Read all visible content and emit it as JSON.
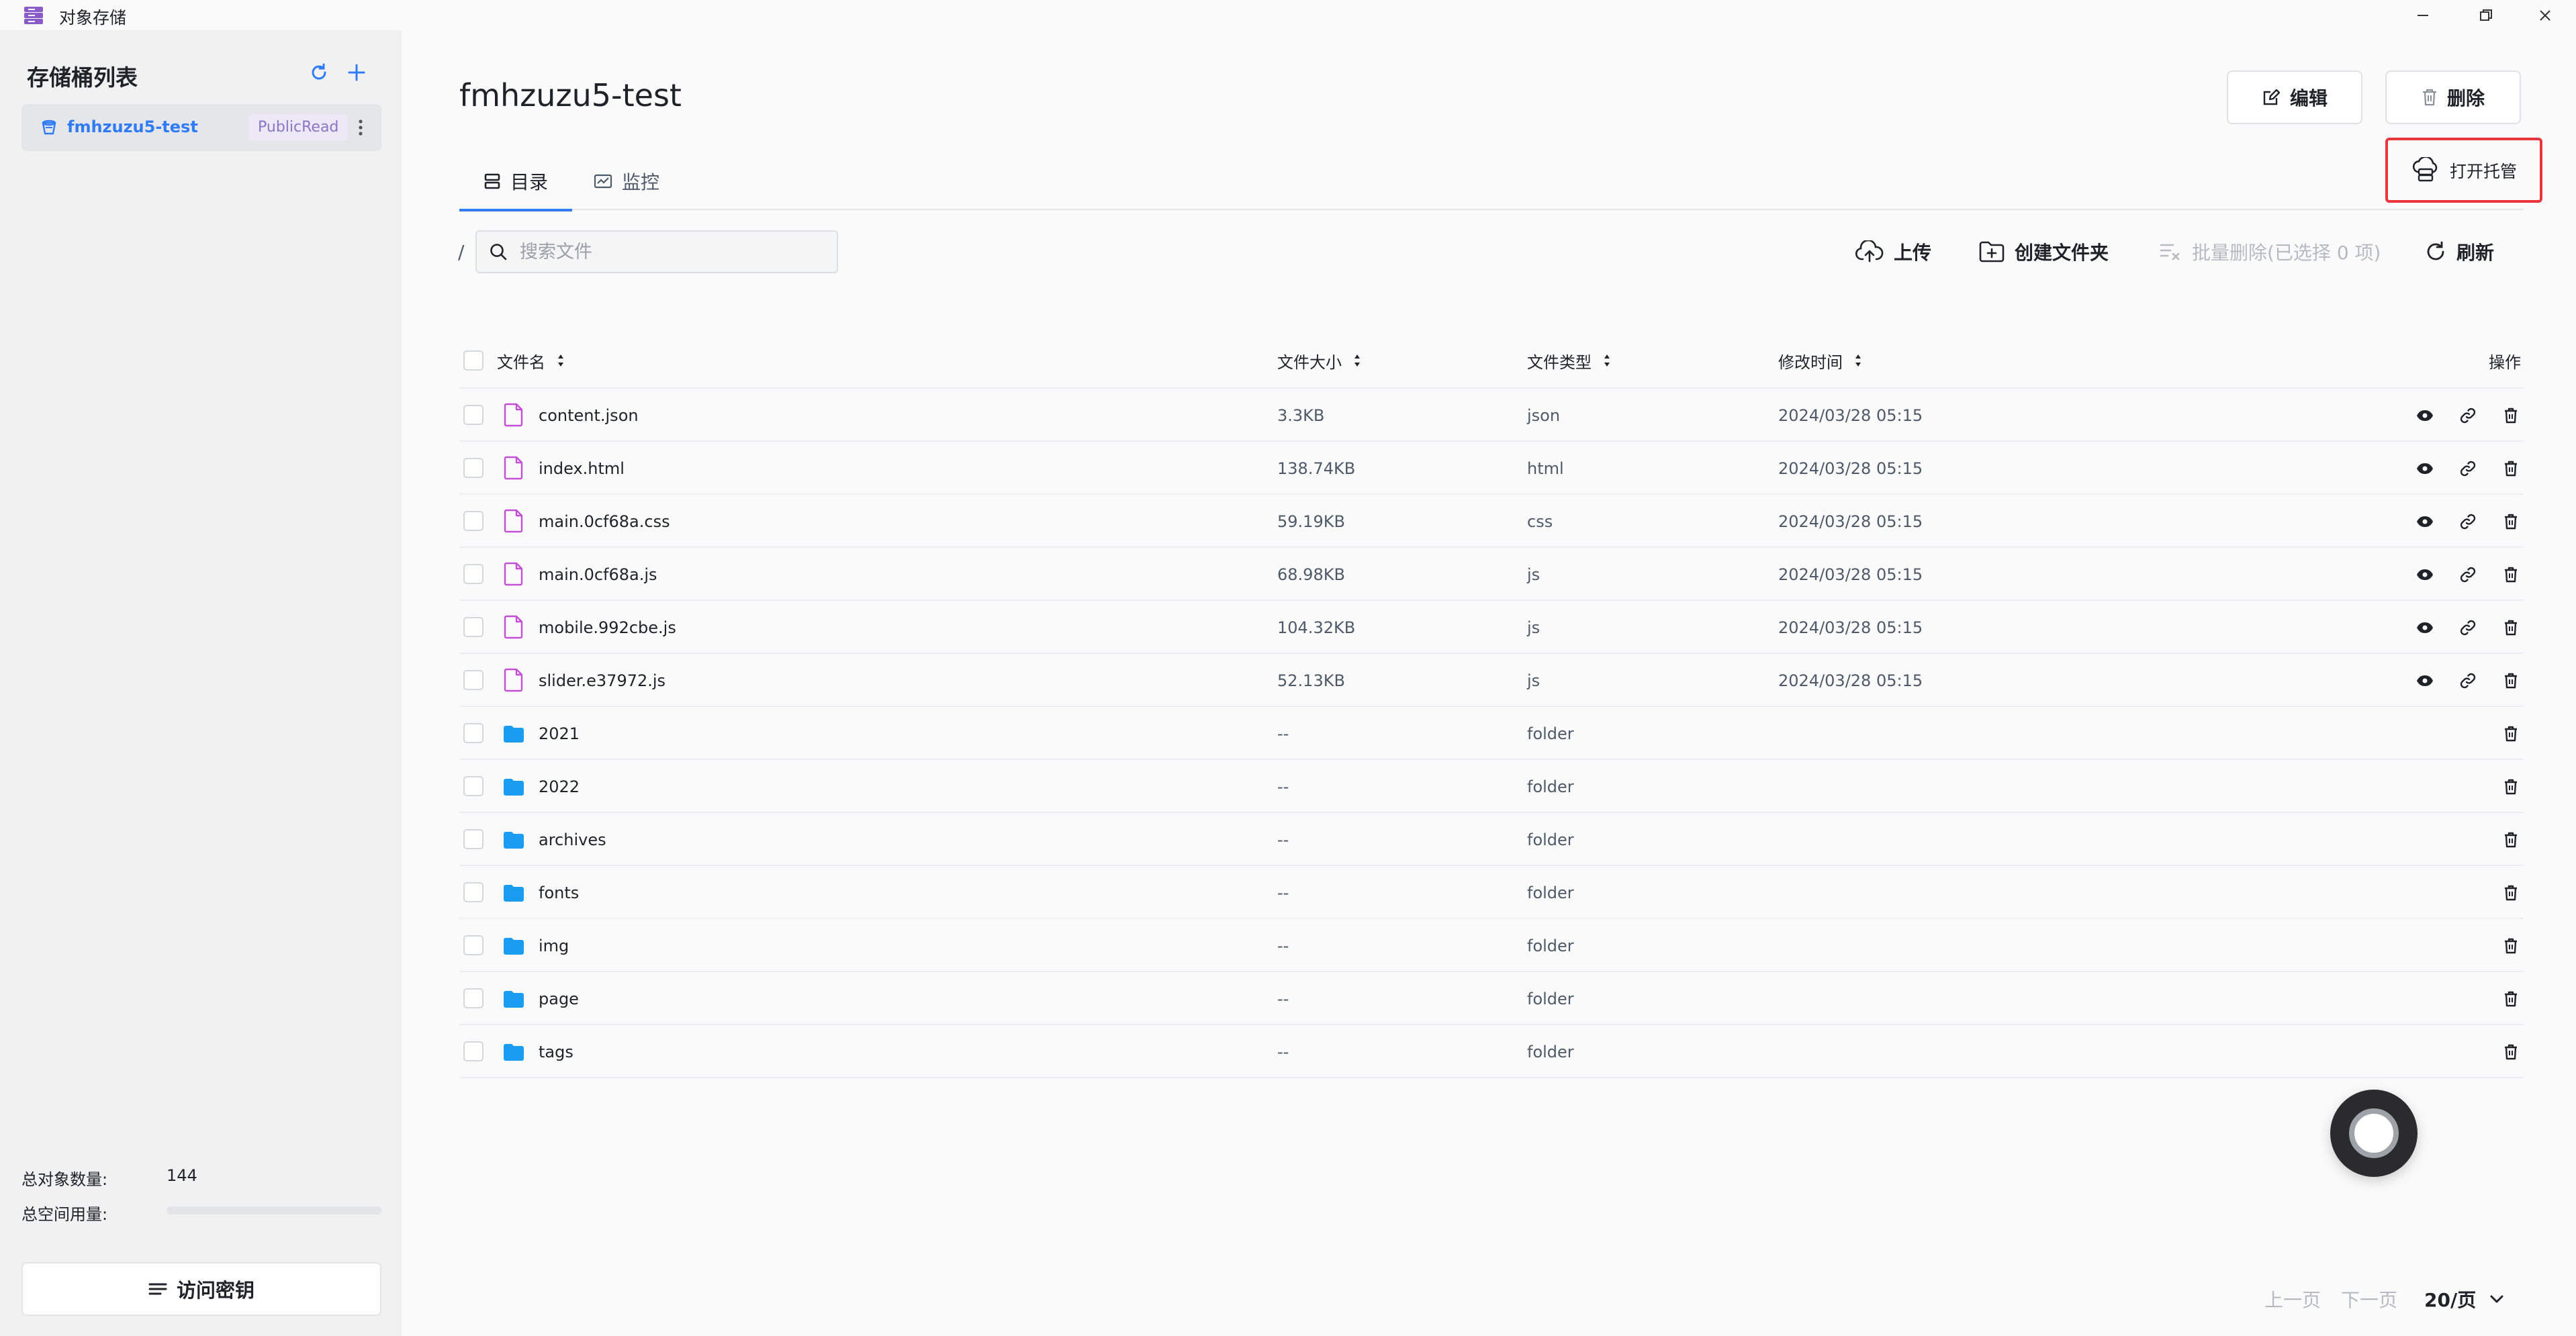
{
  "window": {
    "title": "对象存储",
    "colors": {
      "brand": "#8a5cc9",
      "accent": "#2f7cf6",
      "highlight_border": "#e8343a",
      "file_icon": "#c44fd6",
      "folder_icon": "#1a9cf0"
    }
  },
  "sidebar": {
    "title": "存储桶列表",
    "buckets": [
      {
        "name": "fmhzuzu5-test",
        "badge": "PublicRead",
        "icon": "bucket-icon"
      }
    ],
    "stats": {
      "object_count_label": "总对象数量:",
      "object_count_value": "144",
      "space_used_label": "总空间用量:",
      "space_used_fraction": 0
    },
    "access_key_button": "访问密钥"
  },
  "main": {
    "title": "fmhzuzu5-test",
    "edit_button": "编辑",
    "delete_button": "删除",
    "host_button": "打开托管",
    "tabs": [
      {
        "label": "目录",
        "icon": "list-icon",
        "active": true
      },
      {
        "label": "监控",
        "icon": "monitor-icon",
        "active": false
      }
    ],
    "path": "/",
    "search_placeholder": "搜索文件",
    "toolbar": {
      "upload": "上传",
      "create_folder": "创建文件夹",
      "batch_delete": "批量删除(已选择 0 项)",
      "refresh": "刷新"
    },
    "columns": {
      "name": "文件名",
      "size": "文件大小",
      "type": "文件类型",
      "modified": "修改时间",
      "actions": "操作"
    },
    "rows": [
      {
        "name": "content.json",
        "size": "3.3KB",
        "type": "json",
        "modified": "2024/03/28 05:15"
      },
      {
        "name": "index.html",
        "size": "138.74KB",
        "type": "html",
        "modified": "2024/03/28 05:15"
      },
      {
        "name": "main.0cf68a.css",
        "size": "59.19KB",
        "type": "css",
        "modified": "2024/03/28 05:15"
      },
      {
        "name": "main.0cf68a.js",
        "size": "68.98KB",
        "type": "js",
        "modified": "2024/03/28 05:15"
      },
      {
        "name": "mobile.992cbe.js",
        "size": "104.32KB",
        "type": "js",
        "modified": "2024/03/28 05:15"
      },
      {
        "name": "slider.e37972.js",
        "size": "52.13KB",
        "type": "js",
        "modified": "2024/03/28 05:15"
      },
      {
        "name": "2021",
        "size": "--",
        "type": "folder",
        "modified": ""
      },
      {
        "name": "2022",
        "size": "--",
        "type": "folder",
        "modified": ""
      },
      {
        "name": "archives",
        "size": "--",
        "type": "folder",
        "modified": ""
      },
      {
        "name": "fonts",
        "size": "--",
        "type": "folder",
        "modified": ""
      },
      {
        "name": "img",
        "size": "--",
        "type": "folder",
        "modified": ""
      },
      {
        "name": "page",
        "size": "--",
        "type": "folder",
        "modified": ""
      },
      {
        "name": "tags",
        "size": "--",
        "type": "folder",
        "modified": ""
      }
    ],
    "pagination": {
      "prev": "上一页",
      "next": "下一页",
      "page_size": "20/页"
    }
  }
}
